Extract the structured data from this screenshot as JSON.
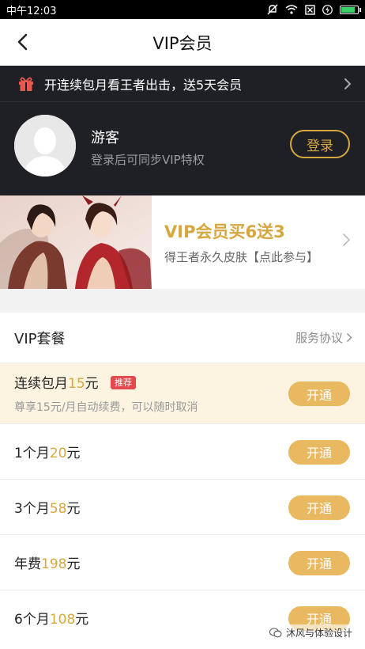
{
  "status": {
    "time": "中午12:03",
    "icons": [
      "mute-icon",
      "wifi-icon",
      "sim-icon",
      "flash-icon",
      "battery-icon"
    ]
  },
  "nav": {
    "title": "VIP会员",
    "back_icon": "back-arrow-icon"
  },
  "promo": {
    "text": "开连续包月看王者出击，送5天会员",
    "icon": "gift-icon"
  },
  "user": {
    "name": "游客",
    "subtitle": "登录后可同步VIP特权",
    "login_label": "登录"
  },
  "banner": {
    "title": "VIP会员买6送3",
    "subtitle": "得王者永久皮肤【点此参与】"
  },
  "plans_section": {
    "title": "VIP套餐",
    "agreement_link": "服务协议"
  },
  "plans": [
    {
      "name_prefix": "连续包月",
      "price": "15",
      "unit": "元",
      "tag": "推荐",
      "desc": "尊享15元/月自动续费，可以随时取消",
      "button": "开通"
    },
    {
      "name_prefix": "1个月",
      "price": "20",
      "unit": "元",
      "button": "开通"
    },
    {
      "name_prefix": "3个月",
      "price": "58",
      "unit": "元",
      "button": "开通"
    },
    {
      "name_prefix": "年费",
      "price": "198",
      "unit": "元",
      "button": "开通"
    },
    {
      "name_prefix": "6个月",
      "price": "108",
      "unit": "元",
      "button": "开通"
    }
  ],
  "watermark": "沐风与体验设计",
  "colors": {
    "gold": "#d6a73f",
    "button": "#e8b960",
    "dark_header": "#1f2026",
    "featured_bg": "#fdf3e1",
    "tag_red": "#e5484d"
  }
}
